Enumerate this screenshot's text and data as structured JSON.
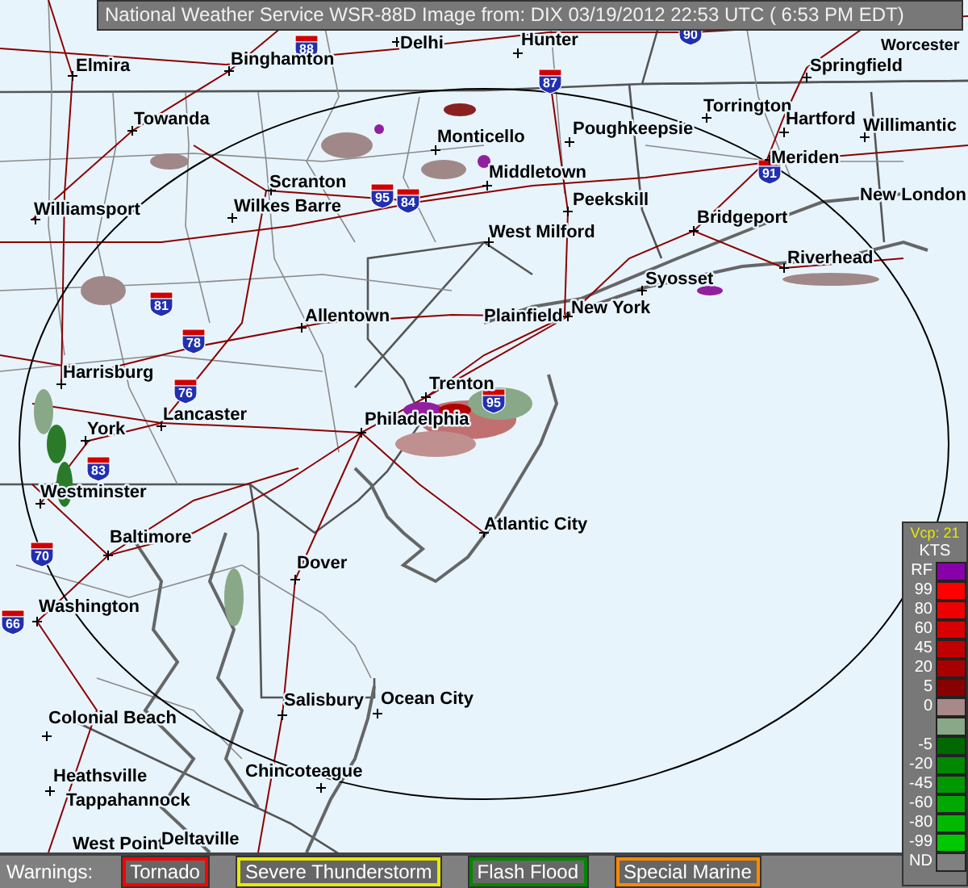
{
  "title": "National Weather Service WSR-88D Image from: DIX 03/19/2012 22:53 UTC ( 6:53 PM EDT)",
  "map": {
    "cities": [
      {
        "name": "Elmira"
      },
      {
        "name": "Binghamton"
      },
      {
        "name": "Delhi"
      },
      {
        "name": "Hunter"
      },
      {
        "name": "Worcester"
      },
      {
        "name": "Springfield"
      },
      {
        "name": "Towanda"
      },
      {
        "name": "Monticello"
      },
      {
        "name": "Poughkeepsie"
      },
      {
        "name": "Torrington"
      },
      {
        "name": "Hartford"
      },
      {
        "name": "Willimantic"
      },
      {
        "name": "Meriden"
      },
      {
        "name": "New London"
      },
      {
        "name": "Scranton"
      },
      {
        "name": "Middletown"
      },
      {
        "name": "Peekskill"
      },
      {
        "name": "Williamsport"
      },
      {
        "name": "Wilkes Barre"
      },
      {
        "name": "Bridgeport"
      },
      {
        "name": "West Milford"
      },
      {
        "name": "Riverhead"
      },
      {
        "name": "Syosset"
      },
      {
        "name": "Allentown"
      },
      {
        "name": "Plainfield"
      },
      {
        "name": "New York"
      },
      {
        "name": "Harrisburg"
      },
      {
        "name": "Trenton"
      },
      {
        "name": "Lancaster"
      },
      {
        "name": "York"
      },
      {
        "name": "Philadelphia"
      },
      {
        "name": "Westminster"
      },
      {
        "name": "Atlantic City"
      },
      {
        "name": "Baltimore"
      },
      {
        "name": "Dover"
      },
      {
        "name": "Washington"
      },
      {
        "name": "Salisbury"
      },
      {
        "name": "Ocean City"
      },
      {
        "name": "Colonial Beach"
      },
      {
        "name": "Heathsville"
      },
      {
        "name": "Chincoteague"
      },
      {
        "name": "Tappahannock"
      },
      {
        "name": "West Point"
      },
      {
        "name": "Deltaville"
      }
    ],
    "shields": [
      {
        "number": "88"
      },
      {
        "number": "87"
      },
      {
        "number": "90"
      },
      {
        "number": "84"
      },
      {
        "number": "91"
      },
      {
        "number": "95"
      },
      {
        "number": "81"
      },
      {
        "number": "78"
      },
      {
        "number": "76"
      },
      {
        "number": "95"
      },
      {
        "number": "83"
      },
      {
        "number": "70"
      },
      {
        "number": "66"
      }
    ]
  },
  "legend": {
    "title": "Vcp: 21",
    "unit": "KTS",
    "items": [
      {
        "label": "RF",
        "color": "#8800a8"
      },
      {
        "label": "99",
        "color": "#ff0000"
      },
      {
        "label": "80",
        "color": "#ee0000"
      },
      {
        "label": "60",
        "color": "#d80000"
      },
      {
        "label": "45",
        "color": "#c00000"
      },
      {
        "label": "20",
        "color": "#a80000"
      },
      {
        "label": "5",
        "color": "#880000"
      },
      {
        "label": "0",
        "color": "#a88888"
      },
      {
        "color": "#88a888"
      },
      {
        "label": "-5",
        "color": "#006800"
      },
      {
        "label": "-20",
        "color": "#008800"
      },
      {
        "label": "-45",
        "color": "#009800"
      },
      {
        "label": "-60",
        "color": "#00a800"
      },
      {
        "label": "-80",
        "color": "#00b800"
      },
      {
        "label": "-99",
        "color": "#00c800"
      },
      {
        "label": "ND",
        "color": "#808080"
      }
    ]
  },
  "warnings": {
    "label": "Warnings:",
    "items": [
      {
        "label": "Tornado",
        "color": "#ff0000"
      },
      {
        "label": "Severe Thunderstorm",
        "color": "#e8e800"
      },
      {
        "label": "Flash Flood",
        "color": "#008800"
      },
      {
        "label": "Special Marine",
        "color": "#ff8800"
      }
    ]
  }
}
